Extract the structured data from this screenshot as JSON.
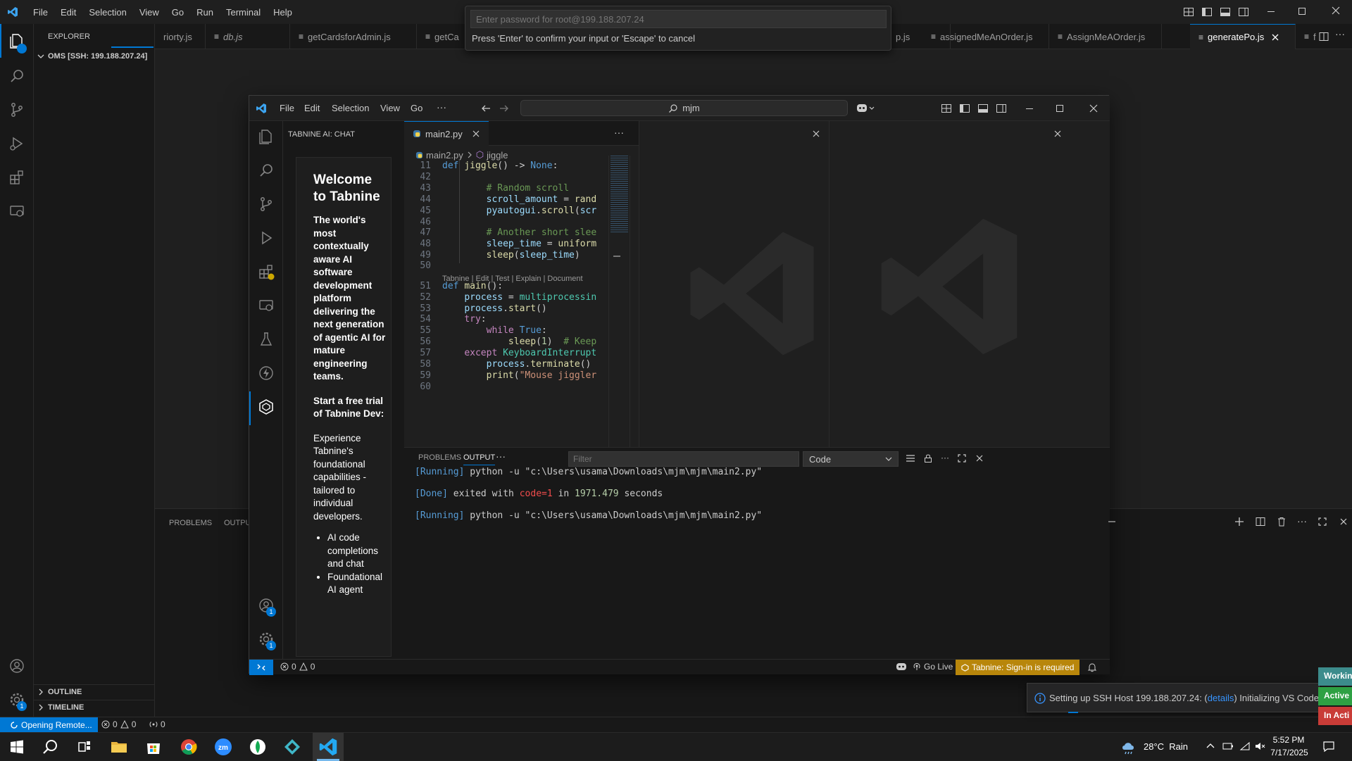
{
  "outer": {
    "menu": [
      "File",
      "Edit",
      "Selection",
      "View",
      "Go",
      "Run",
      "Terminal",
      "Help"
    ],
    "explorer_title": "EXPLORER",
    "workspace": "OMS [SSH: 199.188.207.24]",
    "outline": "OUTLINE",
    "timeline": "TIMELINE",
    "panel_tabs": [
      "PROBLEMS",
      "OUTPU"
    ],
    "tabs": [
      {
        "label": "riorty.js",
        "icon": "js-file-icon"
      },
      {
        "label": "db.js",
        "icon": "js-file-icon"
      },
      {
        "label": "getCardsforAdmin.js",
        "icon": "js-file-icon"
      },
      {
        "label": "getCa",
        "icon": "js-file-icon"
      },
      {
        "label": "p.js",
        "icon": "js-file-icon"
      },
      {
        "label": "assignedMeAnOrder.js",
        "icon": "js-file-icon"
      },
      {
        "label": "AssignMeAOrder.js",
        "icon": "js-file-icon"
      },
      {
        "label": "generatePo.js",
        "icon": "js-file-icon"
      }
    ],
    "extra_tab": "f",
    "status": {
      "remote": "Opening Remote...",
      "errors": "0",
      "warnings": "0",
      "ports": "0"
    },
    "account_badge": "1"
  },
  "command_palette": {
    "placeholder": "Enter password for root@199.188.207.24",
    "message": "Press 'Enter' to confirm your input or 'Escape' to cancel"
  },
  "inner": {
    "menu": [
      "File",
      "Edit",
      "Selection",
      "View",
      "Go",
      "···"
    ],
    "search_text": "mjm",
    "sidebar_title": "TABNINE AI: CHAT",
    "welcome": {
      "heading": "Welcome to Tabnine",
      "intro": "The world's most contextually aware AI software development platform delivering the next generation of agentic AI for mature engineering teams.",
      "trial": "Start a free trial of Tabnine Dev:",
      "body": "Experience Tabnine's foundational capabilities - tailored to individual developers.",
      "bullets": [
        "AI code completions and chat",
        "Foundational AI agent"
      ]
    },
    "editor_tab": "main2.py",
    "breadcrumb": {
      "file": "main2.py",
      "symbol": "jiggle"
    },
    "codelens": "Tabnine | Edit | Test | Explain | Document",
    "panel_tabs": {
      "problems": "PROBLEMS",
      "output": "OUTPUT",
      "more": "···"
    },
    "filter_placeholder": "Filter",
    "output_channel": "Code",
    "output_lines": [
      {
        "tag": "[Running]",
        "text": " python -u \"c:\\Users\\usama\\Downloads\\mjm\\mjm\\main2.py\""
      },
      {
        "tag": "[Done]",
        "pre": " exited with ",
        "code": "code=1",
        "mid": " in ",
        "num": "1971.479",
        "post": " seconds"
      },
      {
        "tag": "[Running]",
        "text": " python -u \"c:\\Users\\usama\\Downloads\\mjm\\mjm\\main2.py\""
      }
    ],
    "status": {
      "errors": "0",
      "warnings": "0",
      "go_live": "Go Live",
      "tabnine": "Tabnine: Sign-in is required"
    },
    "badges": {
      "account": "1",
      "settings": "1"
    }
  },
  "code_lines": [
    {
      "n": "11",
      "html": "<span class='kb'>def</span> <span class='fn'>jiggle</span>() -> <span class='kb'>None</span>:"
    },
    {
      "n": "42",
      "html": ""
    },
    {
      "n": "43",
      "html": "        <span class='cm'># Random scroll</span>"
    },
    {
      "n": "44",
      "html": "        <span class='vr'>scroll_amount</span> = <span class='fn'>rand</span>"
    },
    {
      "n": "45",
      "html": "        <span class='vr'>pyautogui</span>.<span class='fn'>scroll</span>(<span class='vr'>scr</span>"
    },
    {
      "n": "46",
      "html": ""
    },
    {
      "n": "47",
      "html": "        <span class='cm'># Another short slee</span>"
    },
    {
      "n": "48",
      "html": "        <span class='vr'>sleep_time</span> = <span class='fn'>uniform</span>"
    },
    {
      "n": "49",
      "html": "        <span class='fn'>sleep</span>(<span class='vr'>sleep_time</span>)"
    },
    {
      "n": "50",
      "html": ""
    },
    {
      "n": "51",
      "html": "<span class='kb'>def</span> <span class='fn'>main</span>():"
    },
    {
      "n": "52",
      "html": "    <span class='vr'>process</span> = <span class='ty'>multiprocessin</span>"
    },
    {
      "n": "53",
      "html": "    <span class='vr'>process</span>.<span class='fn'>start</span>()"
    },
    {
      "n": "54",
      "html": "    <span class='kw'>try</span>:"
    },
    {
      "n": "55",
      "html": "        <span class='kw'>while</span> <span class='kb'>True</span>:"
    },
    {
      "n": "56",
      "html": "            <span class='fn'>sleep</span>(<span style='color:#b5cea8'>1</span>)  <span class='cm'># Keep</span>"
    },
    {
      "n": "57",
      "html": "    <span class='kw'>except</span> <span class='ty'>KeyboardInterrupt</span>"
    },
    {
      "n": "58",
      "html": "        <span class='vr'>process</span>.<span class='fn'>terminate</span>()"
    },
    {
      "n": "59",
      "html": "        <span class='fn'>print</span>(<span class='st'>\"Mouse jiggler</span>"
    },
    {
      "n": "60",
      "html": ""
    }
  ],
  "notification": {
    "text_before": "Setting up SSH Host 199.188.207.24: (",
    "link": "details",
    "text_after": ") Initializing VS Code"
  },
  "side_badges": [
    {
      "label": "Workin",
      "color": "#3c8c8c"
    },
    {
      "label": "Active",
      "color": "#2ea043"
    },
    {
      "label": "In Acti",
      "color": "#c93c37"
    }
  ],
  "taskbar": {
    "weather": "28°C  Rain",
    "time": "5:52 PM",
    "date": "7/17/2025"
  }
}
